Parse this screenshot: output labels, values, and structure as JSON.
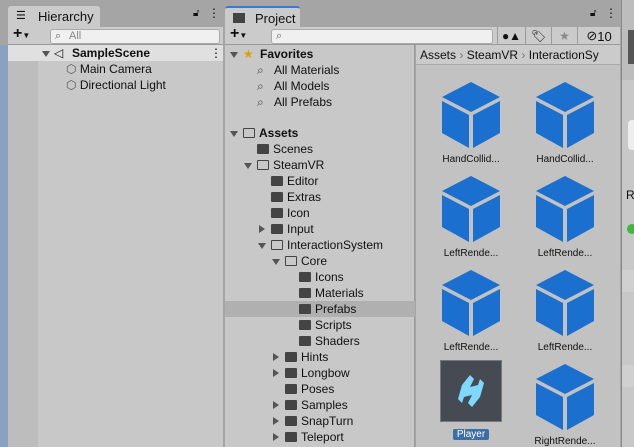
{
  "hierarchy": {
    "tab": "Hierarchy",
    "search_placeholder": "All",
    "scene": "SampleScene",
    "objects": [
      "Main Camera",
      "Directional Light"
    ]
  },
  "project": {
    "tab": "Project",
    "hidden_count": "10",
    "favorites": {
      "label": "Favorites",
      "items": [
        "All Materials",
        "All Models",
        "All Prefabs"
      ]
    },
    "tree": [
      {
        "label": "Assets",
        "depth": 0,
        "state": "open"
      },
      {
        "label": "Scenes",
        "depth": 1,
        "state": "none"
      },
      {
        "label": "SteamVR",
        "depth": 1,
        "state": "open"
      },
      {
        "label": "Editor",
        "depth": 2,
        "state": "none"
      },
      {
        "label": "Extras",
        "depth": 2,
        "state": "none"
      },
      {
        "label": "Icon",
        "depth": 2,
        "state": "none"
      },
      {
        "label": "Input",
        "depth": 2,
        "state": "closed"
      },
      {
        "label": "InteractionSystem",
        "depth": 2,
        "state": "open"
      },
      {
        "label": "Core",
        "depth": 3,
        "state": "open"
      },
      {
        "label": "Icons",
        "depth": 4,
        "state": "none"
      },
      {
        "label": "Materials",
        "depth": 4,
        "state": "none"
      },
      {
        "label": "Prefabs",
        "depth": 4,
        "state": "none",
        "selected": true
      },
      {
        "label": "Scripts",
        "depth": 4,
        "state": "none"
      },
      {
        "label": "Shaders",
        "depth": 4,
        "state": "none"
      },
      {
        "label": "Hints",
        "depth": 3,
        "state": "closed"
      },
      {
        "label": "Longbow",
        "depth": 3,
        "state": "closed"
      },
      {
        "label": "Poses",
        "depth": 3,
        "state": "none"
      },
      {
        "label": "Samples",
        "depth": 3,
        "state": "closed"
      },
      {
        "label": "SnapTurn",
        "depth": 3,
        "state": "closed"
      },
      {
        "label": "Teleport",
        "depth": 3,
        "state": "closed"
      }
    ],
    "breadcrumb": [
      "Assets",
      "SteamVR",
      "InteractionSy"
    ],
    "assets": [
      {
        "label": "HandCollid...",
        "kind": "prefab"
      },
      {
        "label": "HandCollid...",
        "kind": "prefab"
      },
      {
        "label": "LeftRende...",
        "kind": "prefab"
      },
      {
        "label": "LeftRende...",
        "kind": "prefab"
      },
      {
        "label": "LeftRende...",
        "kind": "prefab"
      },
      {
        "label": "LeftRende...",
        "kind": "prefab"
      },
      {
        "label": "Player",
        "kind": "player",
        "selected": true
      },
      {
        "label": "RightRende...",
        "kind": "prefab"
      }
    ]
  },
  "inspector": {
    "partial_label": "R"
  },
  "colors": {
    "prefab_blue": "#1a6fcf",
    "selection": "#3d6ea8",
    "star": "#e0a000"
  }
}
